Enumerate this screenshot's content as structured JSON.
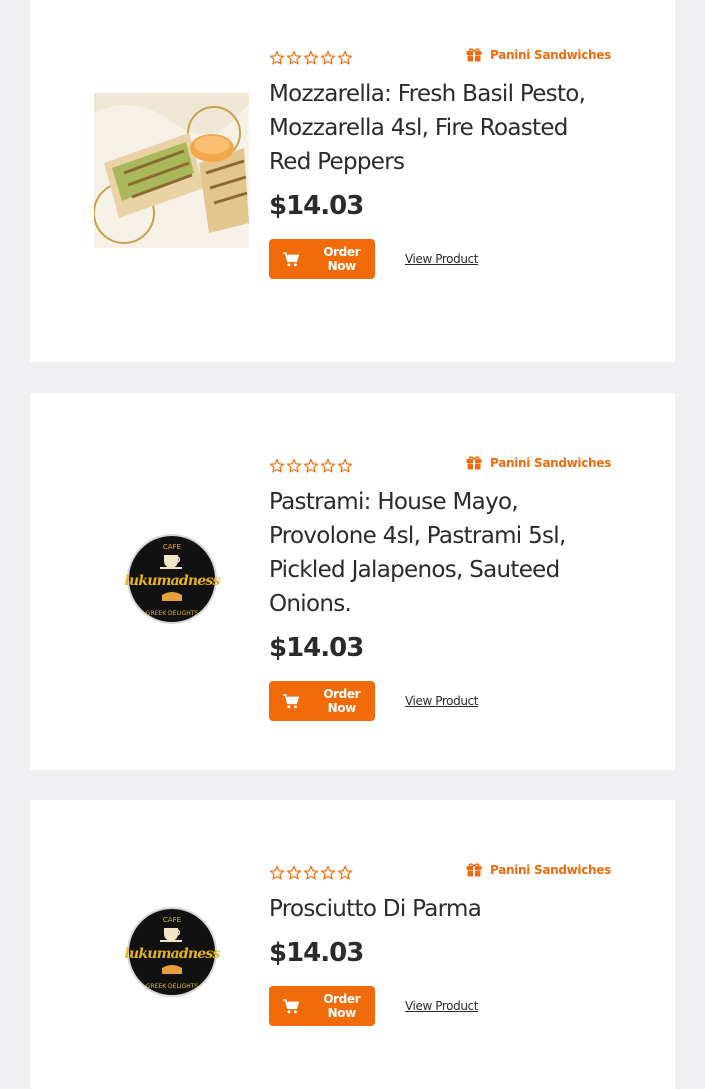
{
  "colors": {
    "accent": "#f26b0a",
    "background": "#f0f0f2",
    "card": "#ffffff",
    "text": "#2b2b2b"
  },
  "products": [
    {
      "image": "panini-wrap-photo",
      "rating_stars": 0,
      "category": "Panini Sandwiches",
      "category_icon": "gift-icon",
      "title": "Mozzarella: Fresh Basil Pesto, Mozzarella 4sl, Fire Roasted Red Peppers",
      "price": "$14.03",
      "order_label": "Order Now",
      "view_label": "View Product"
    },
    {
      "image": "lukumadness-logo",
      "logo_top": "CAFE",
      "logo_name": "lukumadness",
      "logo_bottom": "GREEK DELIGHTS",
      "rating_stars": 0,
      "category": "Panini Sandwiches",
      "category_icon": "gift-icon",
      "title": "Pastrami: House Mayo, Provolone 4sl, Pastrami 5sl, Pickled Jalapenos, Sauteed Onions.",
      "price": "$14.03",
      "order_label": "Order Now",
      "view_label": "View Product"
    },
    {
      "image": "lukumadness-logo",
      "logo_top": "CAFE",
      "logo_name": "lukumadness",
      "logo_bottom": "GREEK DELIGHTS",
      "rating_stars": 0,
      "category": "Panini Sandwiches",
      "category_icon": "gift-icon",
      "title": "Prosciutto Di Parma",
      "price": "$14.03",
      "order_label": "Order Now",
      "view_label": "View Product"
    }
  ]
}
